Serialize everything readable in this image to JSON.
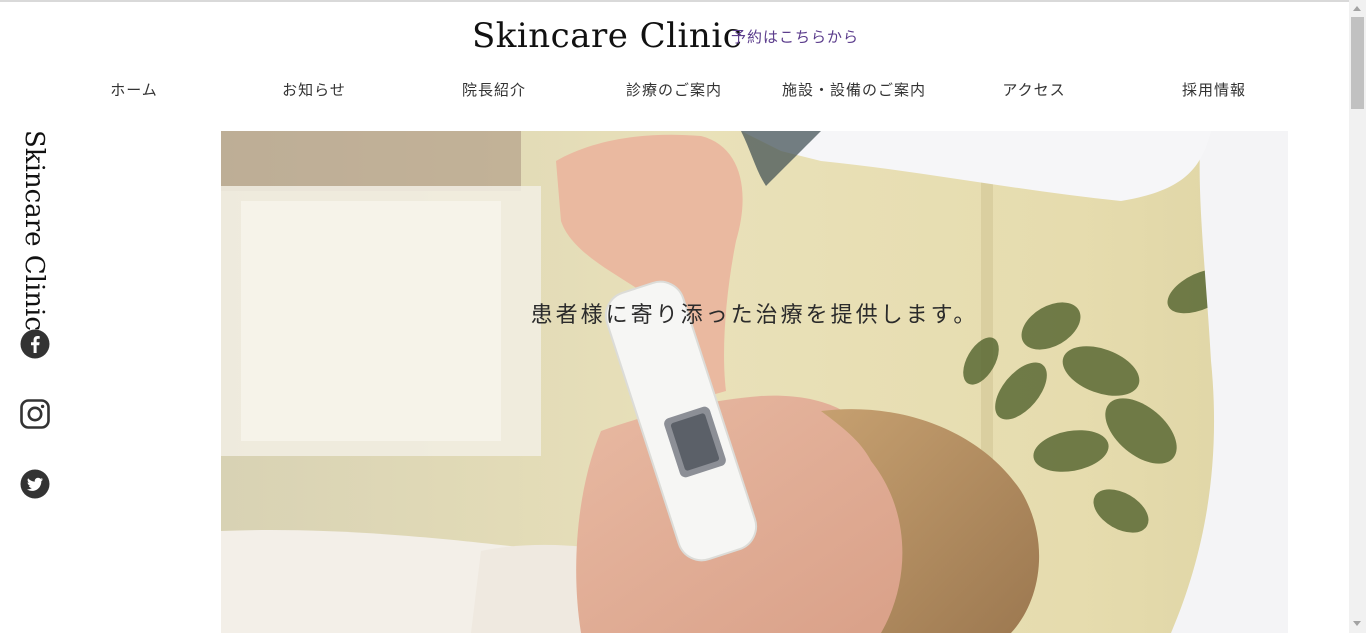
{
  "header": {
    "site_title": "Skincare Clinic",
    "reserve_link": "予約はこちらから"
  },
  "nav": {
    "items": [
      {
        "label": "ホーム"
      },
      {
        "label": "お知らせ"
      },
      {
        "label": "院長紹介"
      },
      {
        "label": "診療のご案内"
      },
      {
        "label": "施設・設備のご案内"
      },
      {
        "label": "アクセス"
      },
      {
        "label": "採用情報"
      }
    ]
  },
  "sidebar": {
    "vertical_title": "Skincare Clinic",
    "social": [
      {
        "icon": "facebook-icon"
      },
      {
        "icon": "instagram-icon"
      },
      {
        "icon": "twitter-icon"
      }
    ]
  },
  "hero": {
    "headline": "患者様に寄り添った治療を提供します。"
  },
  "colors": {
    "reserve_link": "#5b3c8c",
    "hero_wall": "#e8dfb8",
    "icon": "#333333"
  }
}
